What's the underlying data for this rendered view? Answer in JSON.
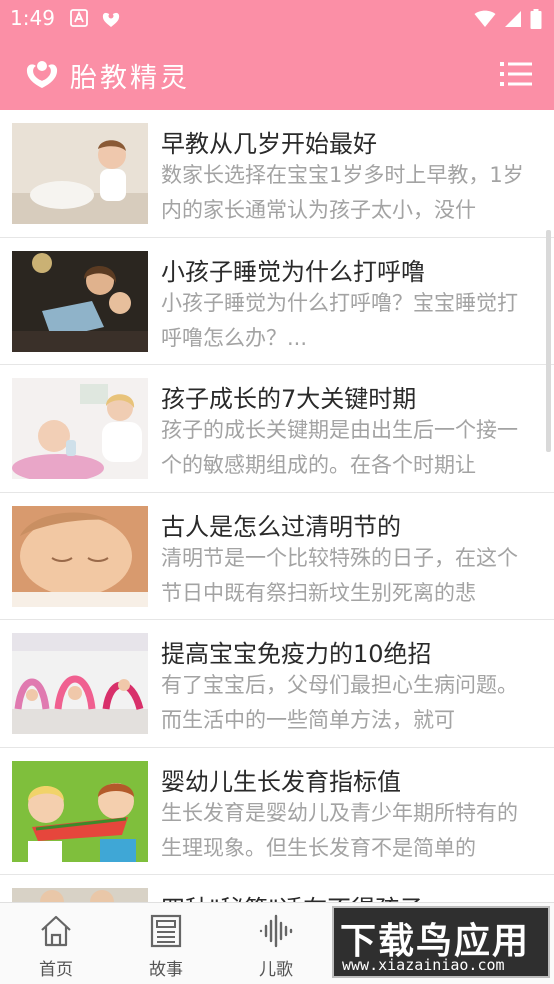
{
  "status_bar": {
    "time": "1:49"
  },
  "app_bar": {
    "title": "胎教精灵"
  },
  "articles": [
    {
      "title": "早教从几岁开始最好",
      "desc": "数家长选择在宝宝1岁多时上早教，1岁内的家长通常认为孩子太小，没什"
    },
    {
      "title": "小孩子睡觉为什么打呼噜",
      "desc": "小孩子睡觉为什么打呼噜？宝宝睡觉打呼噜怎么办？..."
    },
    {
      "title": "孩子成长的7大关键时期",
      "desc": "孩子的成长关键期是由出生后一个接一个的敏感期组成的。在各个时期让"
    },
    {
      "title": "古人是怎么过清明节的",
      "desc": "清明节是一个比较特殊的日子，在这个节日中既有祭扫新坟生别死离的悲"
    },
    {
      "title": "提高宝宝免疫力的10绝招",
      "desc": "有了宝宝后，父母们最担心生病问题。而生活中的一些简单方法，就可"
    },
    {
      "title": "婴幼儿生长发育指标值",
      "desc": "生长发育是婴幼儿及青少年期所特有的生理现象。但生长发育不是简单的"
    },
    {
      "title": "四种\"秘籍\"适在不得孩子",
      "desc": ""
    }
  ],
  "bottom_nav": [
    {
      "label": "首页"
    },
    {
      "label": "故事"
    },
    {
      "label": "儿歌"
    }
  ],
  "watermark": {
    "text": "下载鸟应用",
    "url": "www.xiazainiao.com"
  },
  "colors": {
    "primary": "#fb8fa6",
    "title_text": "#2a2a2a",
    "desc_text": "#a3a3a3"
  }
}
